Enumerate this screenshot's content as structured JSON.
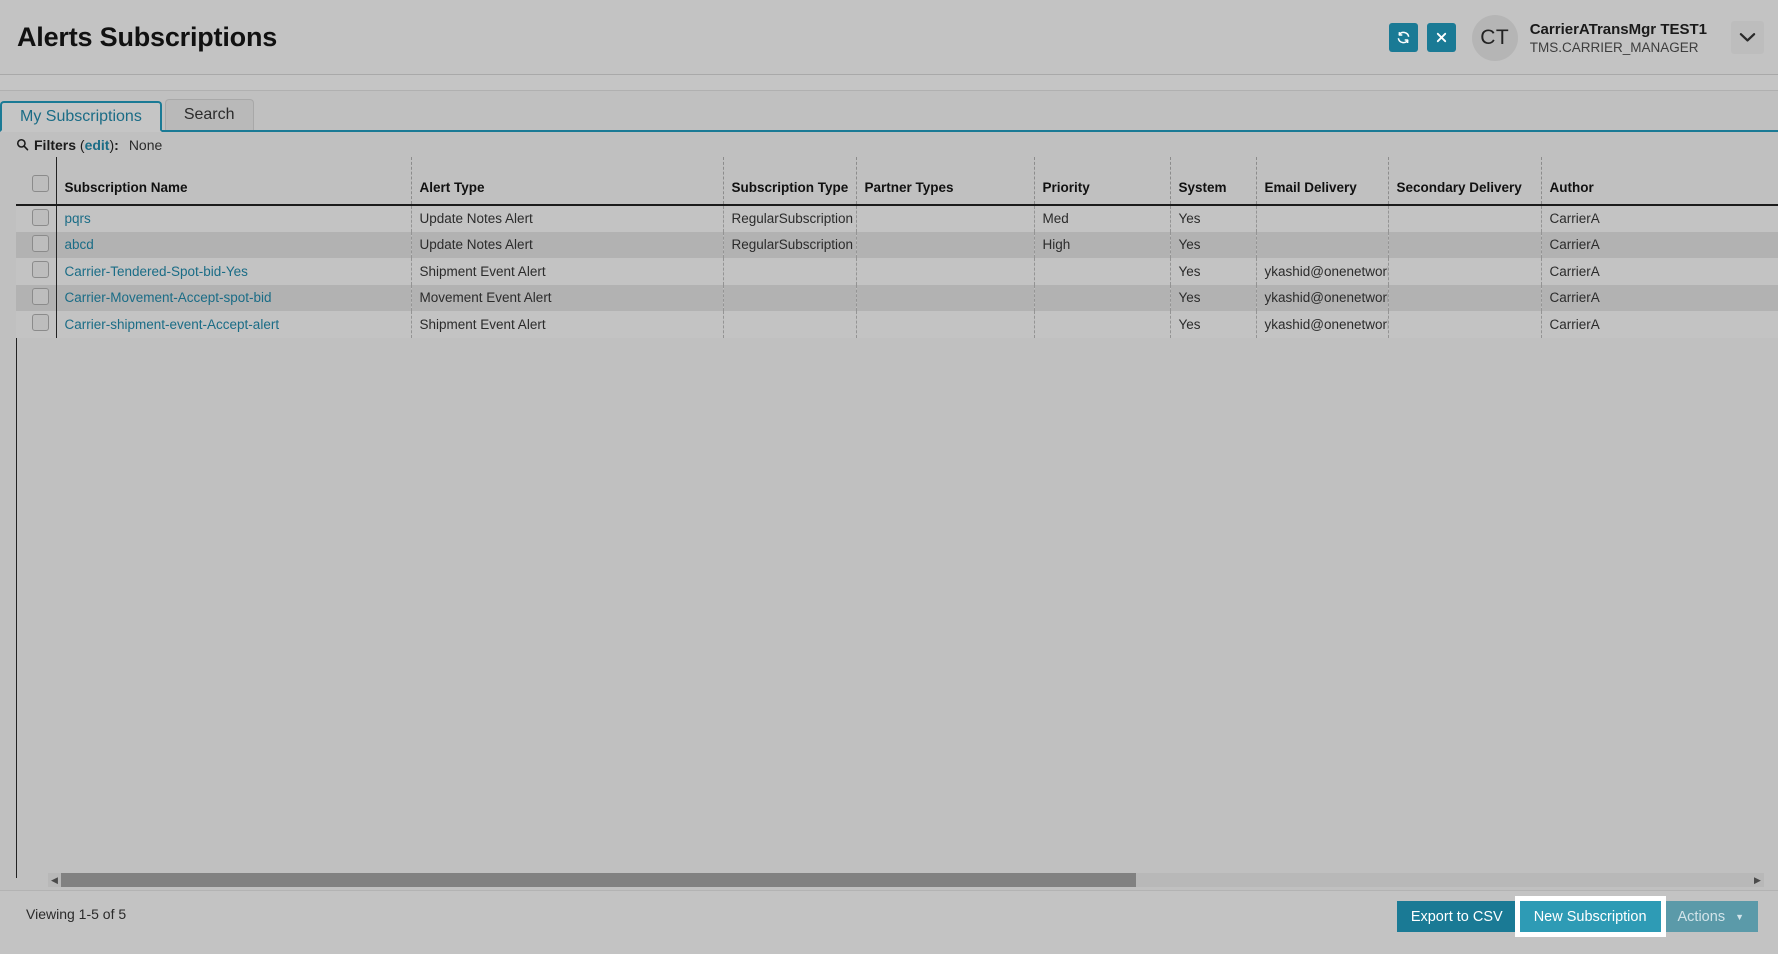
{
  "header": {
    "title": "Alerts Subscriptions",
    "refresh_icon": "refresh-icon",
    "close_icon": "close-icon",
    "avatar_initials": "CT",
    "user_name": "CarrierATransMgr TEST1",
    "user_role": "TMS.CARRIER_MANAGER",
    "chevron_icon": "chevron-down-icon",
    "accent_color": "#1a7a95"
  },
  "tabs": [
    {
      "label": "My Subscriptions",
      "active": true
    },
    {
      "label": "Search",
      "active": false
    }
  ],
  "filters": {
    "icon": "search-icon",
    "label": "Filters",
    "edit_label": "edit",
    "separator": ":",
    "value": "None"
  },
  "grid": {
    "columns": [
      "Subscription Name",
      "Alert Type",
      "Subscription Type",
      "Partner Types",
      "Priority",
      "System",
      "Email Delivery",
      "Secondary Delivery",
      "Author"
    ],
    "rows": [
      {
        "name": "pqrs",
        "alert_type": "Update Notes Alert",
        "subscription_type": "RegularSubscription",
        "partner_types": "",
        "priority": "Med",
        "system": "Yes",
        "email_delivery": "",
        "secondary_delivery": "",
        "author": "CarrierA"
      },
      {
        "name": "abcd",
        "alert_type": "Update Notes Alert",
        "subscription_type": "RegularSubscription",
        "partner_types": "",
        "priority": "High",
        "system": "Yes",
        "email_delivery": "",
        "secondary_delivery": "",
        "author": "CarrierA"
      },
      {
        "name": "Carrier-Tendered-Spot-bid-Yes",
        "alert_type": "Shipment Event Alert",
        "subscription_type": "",
        "partner_types": "",
        "priority": "",
        "system": "Yes",
        "email_delivery": "ykashid@onenetwork.com",
        "secondary_delivery": "",
        "author": "CarrierA"
      },
      {
        "name": "Carrier-Movement-Accept-spot-bid",
        "alert_type": "Movement Event Alert",
        "subscription_type": "",
        "partner_types": "",
        "priority": "",
        "system": "Yes",
        "email_delivery": "ykashid@onenetwork.com",
        "secondary_delivery": "",
        "author": "CarrierA"
      },
      {
        "name": "Carrier-shipment-event-Accept-alert",
        "alert_type": "Shipment Event Alert",
        "subscription_type": "",
        "partner_types": "",
        "priority": "",
        "system": "Yes",
        "email_delivery": "ykashid@onenetwork.com",
        "secondary_delivery": "",
        "author": "CarrierA"
      }
    ]
  },
  "scrollbar": {
    "left_arrow": "chevron-left-icon",
    "right_arrow": "chevron-right-icon"
  },
  "footer": {
    "viewing": "Viewing 1-5 of 5",
    "export_label": "Export to CSV",
    "new_subscription_label": "New Subscription",
    "actions_label": "Actions",
    "actions_caret": "caret-down-icon"
  }
}
